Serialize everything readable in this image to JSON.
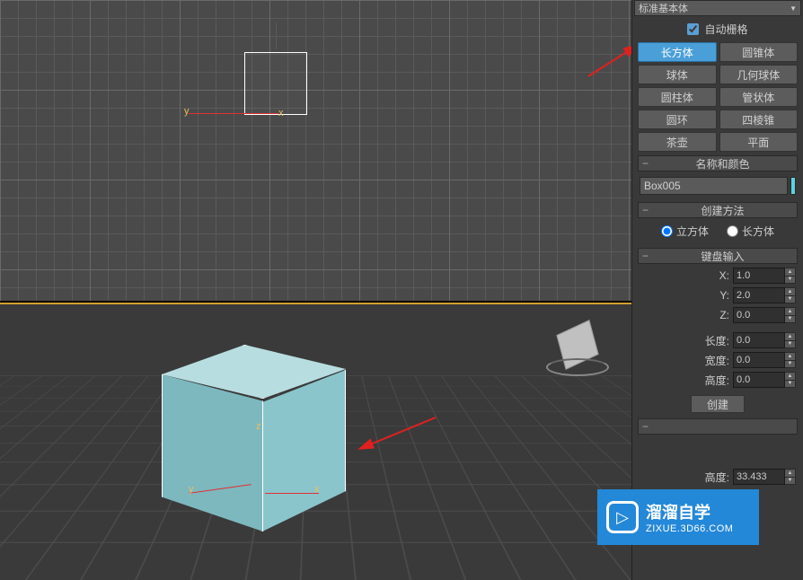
{
  "panel": {
    "category_dropdown": "标准基本体",
    "autogrid_label": "自动栅格",
    "autogrid_checked": true,
    "primitives": [
      {
        "label": "长方体",
        "active": true
      },
      {
        "label": "圆锥体",
        "active": false
      },
      {
        "label": "球体",
        "active": false
      },
      {
        "label": "几何球体",
        "active": false
      },
      {
        "label": "圆柱体",
        "active": false
      },
      {
        "label": "管状体",
        "active": false
      },
      {
        "label": "圆环",
        "active": false
      },
      {
        "label": "四棱锥",
        "active": false
      },
      {
        "label": "茶壶",
        "active": false
      },
      {
        "label": "平面",
        "active": false
      }
    ],
    "rollouts": {
      "name_color": "名称和颜色",
      "creation_method": "创建方法",
      "keyboard_entry": "键盘输入"
    },
    "object_name": "Box005",
    "creation": {
      "cube_label": "立方体",
      "cuboid_label": "长方体",
      "selected": "cube"
    },
    "keyboard": {
      "x_label": "X:",
      "x_value": "1.0",
      "y_label": "Y:",
      "y_value": "2.0",
      "z_label": "Z:",
      "z_value": "0.0",
      "length_label": "长度:",
      "length_value": "0.0",
      "width_label": "宽度:",
      "width_value": "0.0",
      "height_label": "高度:",
      "height_value": "0.0",
      "create_label": "创建"
    },
    "bottom_param": {
      "height_label": "高度:",
      "height_value": "33.433"
    }
  },
  "viewport": {
    "axis_x": "x",
    "axis_y": "y",
    "axis_z": "z"
  },
  "watermark": {
    "line1": "溜溜自学",
    "line2": "ZIXUE.3D66.COM"
  }
}
